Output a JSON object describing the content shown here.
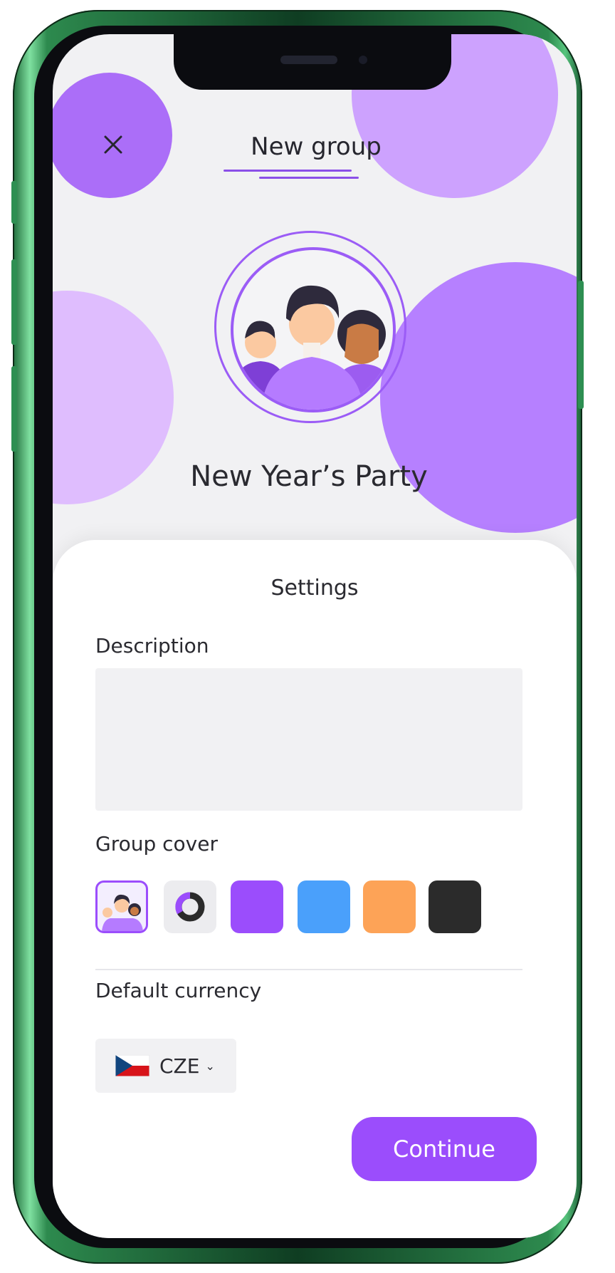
{
  "header": {
    "title": "New group",
    "close_icon": "close-icon"
  },
  "group": {
    "name": "New Year’s Party",
    "avatar_icon": "group-people-icon"
  },
  "settings": {
    "title": "Settings",
    "description_label": "Description",
    "description_value": "",
    "group_cover_label": "Group cover",
    "cover_options": [
      {
        "name": "people",
        "icon": "group-people-icon",
        "selected": true
      },
      {
        "name": "donut",
        "icon": "donut-chart-icon",
        "selected": false
      },
      {
        "name": "purple",
        "color": "#9b4dfc",
        "selected": false
      },
      {
        "name": "blue",
        "color": "#4aa0fb",
        "selected": false
      },
      {
        "name": "orange",
        "color": "#fda357",
        "selected": false
      },
      {
        "name": "black",
        "color": "#2b2b2b",
        "selected": false
      }
    ],
    "currency_label": "Default currency",
    "currency_value": "CZE",
    "currency_flag": "czech-flag-icon"
  },
  "actions": {
    "continue_label": "Continue"
  },
  "colors": {
    "accent": "#9b4dfc",
    "blob_light": "#d8b4fe",
    "blob_mid": "#b57bff",
    "phone_frame": "#2d8a4e"
  }
}
